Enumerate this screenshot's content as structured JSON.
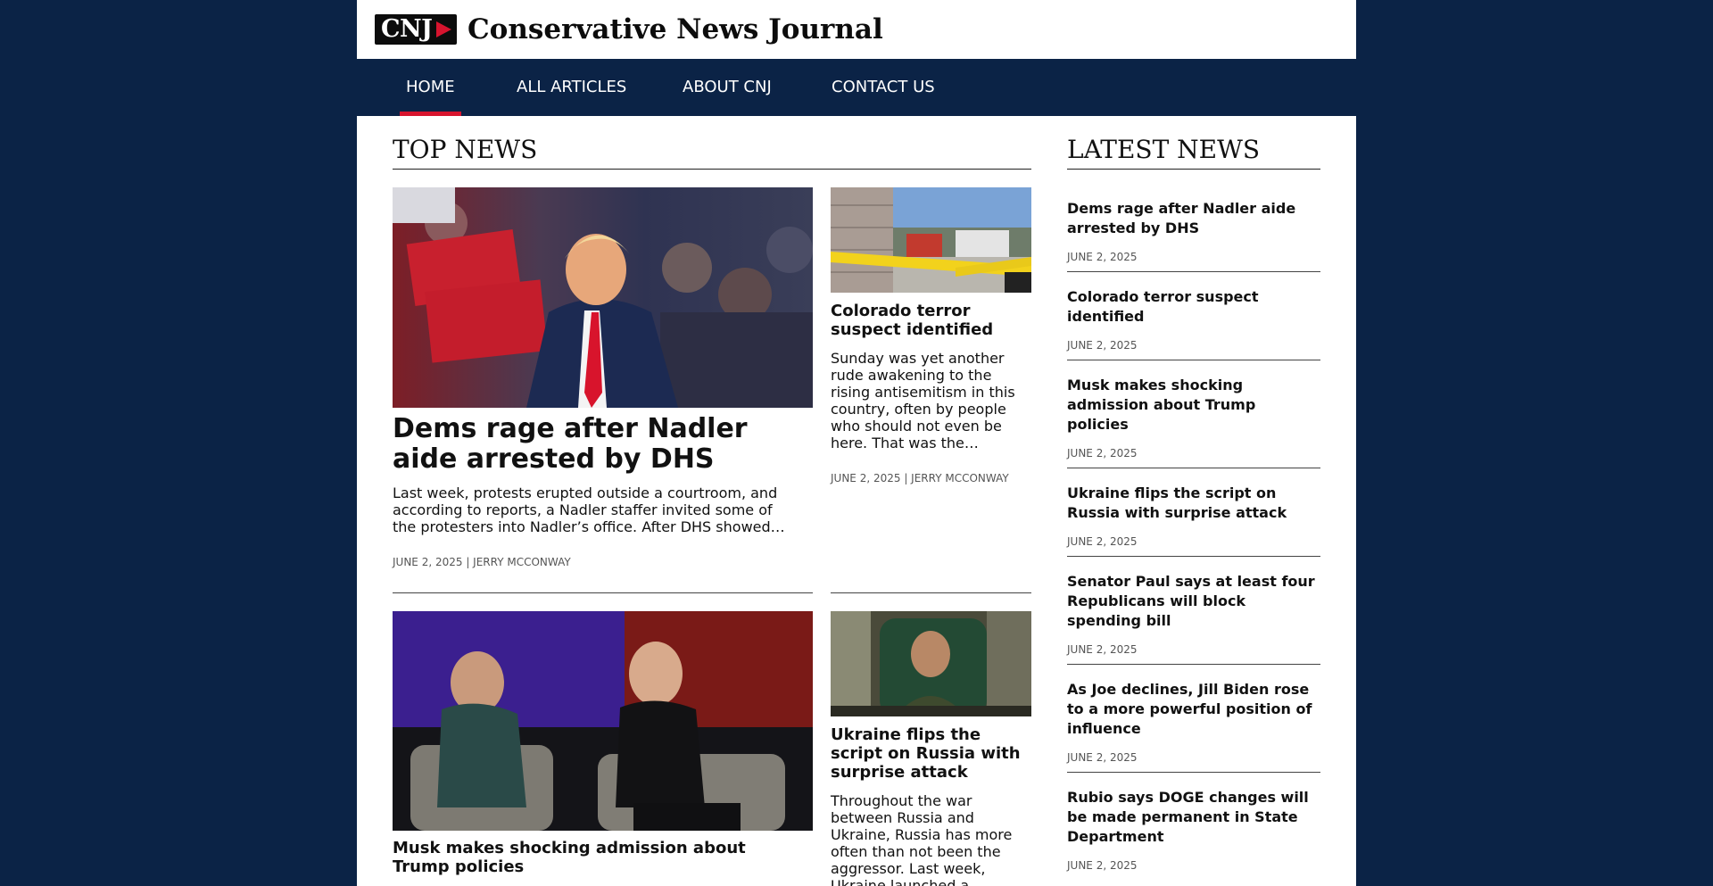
{
  "site": {
    "logo_text": "CNJ",
    "title": "Conservative News Journal"
  },
  "nav": {
    "items": [
      {
        "label": "HOME",
        "active": true
      },
      {
        "label": "ALL ARTICLES",
        "active": false
      },
      {
        "label": "ABOUT CNJ",
        "active": false
      },
      {
        "label": "CONTACT US",
        "active": false
      }
    ]
  },
  "top_news": {
    "heading": "TOP NEWS",
    "featured": {
      "title": "Dems rage after Nadler aide arrested by DHS",
      "excerpt": "Last week, protests erupted outside a courtroom, and according to reports, a Nadler staffer invited some of the protesters into Nadler’s office. After DHS showed…",
      "date": "JUNE 2, 2025",
      "author": "JERRY MCCONWAY",
      "meta": "JUNE 2, 2025 | JERRY MCCONWAY"
    },
    "side": {
      "title": "Colorado terror suspect identified",
      "excerpt": "Sunday was yet another rude awakening to the rising antisemitism in this country, often by people who should not even be here. That was the…",
      "date": "JUNE 2, 2025",
      "author": "JERRY MCCONWAY",
      "meta": "JUNE 2, 2025 | JERRY MCCONWAY"
    },
    "second": {
      "title": "Musk makes shocking admission about Trump policies"
    },
    "second_side": {
      "title": "Ukraine flips the script on Russia with surprise attack",
      "excerpt": "Throughout the war between Russia and Ukraine, Russia has more often than not been the aggressor. Last week, Ukraine launched a massive surprise attack, which…"
    }
  },
  "latest_news": {
    "heading": "LATEST NEWS",
    "items": [
      {
        "title": "Dems rage after Nadler aide arrested by DHS",
        "date": "JUNE 2, 2025"
      },
      {
        "title": "Colorado terror suspect identified",
        "date": "JUNE 2, 2025"
      },
      {
        "title": "Musk makes shocking admission about Trump policies",
        "date": "JUNE 2, 2025"
      },
      {
        "title": "Ukraine flips the script on Russia with surprise attack",
        "date": "JUNE 2, 2025"
      },
      {
        "title": "Senator Paul says at least four Republicans will block spending bill",
        "date": "JUNE 2, 2025"
      },
      {
        "title": "As Joe declines, Jill Biden rose to a more powerful position of influence",
        "date": "JUNE 2, 2025"
      },
      {
        "title": "Rubio says DOGE changes will be made permanent in State Department",
        "date": "JUNE 2, 2025"
      }
    ]
  },
  "colors": {
    "background": "#0b2346",
    "accent": "#d7142e",
    "surface": "#ffffff",
    "text": "#111111",
    "meta": "#555555"
  },
  "images": {
    "featured": "photo: Trump smiling at a rally with Make America Great Again signs behind",
    "side": "photo: crime scene with yellow police tape and emergency vehicles",
    "second": "photo: Elon Musk seated on stage in conversation",
    "second_side": "photo: Zelensky speaking from a green leather chair"
  }
}
